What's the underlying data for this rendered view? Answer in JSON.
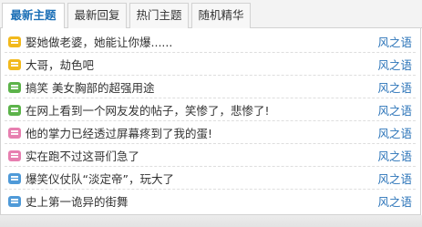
{
  "tabs": [
    {
      "label": "最新主题",
      "active": true
    },
    {
      "label": "最新回复",
      "active": false
    },
    {
      "label": "热门主题",
      "active": false
    },
    {
      "label": "随机精华",
      "active": false
    }
  ],
  "topics": [
    {
      "title": "娶她做老婆，她能让你爆......",
      "author": "风之语",
      "icon": "yellow-topic-icon",
      "color": "#f2b91c"
    },
    {
      "title": "大哥，劫色吧",
      "author": "风之语",
      "icon": "yellow-topic-icon",
      "color": "#f2b91c"
    },
    {
      "title": "搞笑 美女胸部的超强用途",
      "author": "风之语",
      "icon": "green-topic-icon",
      "color": "#5cb34a"
    },
    {
      "title": "在网上看到一个网友发的帖子，笑惨了，悲惨了!",
      "author": "风之语",
      "icon": "green-topic-icon",
      "color": "#5cb34a"
    },
    {
      "title": "他的掌力已经透过屏幕疼到了我的蛋!",
      "author": "风之语",
      "icon": "pink-topic-icon",
      "color": "#e77fb0"
    },
    {
      "title": "实在跑不过这哥们急了",
      "author": "风之语",
      "icon": "pink-topic-icon",
      "color": "#e77fb0"
    },
    {
      "title": "爆笑仪仗队“淡定帝”，玩大了",
      "author": "风之语",
      "icon": "blue-topic-icon",
      "color": "#4f9ad8"
    },
    {
      "title": "史上第一诡异的街舞",
      "author": "风之语",
      "icon": "blue-topic-icon",
      "color": "#4f9ad8"
    }
  ]
}
